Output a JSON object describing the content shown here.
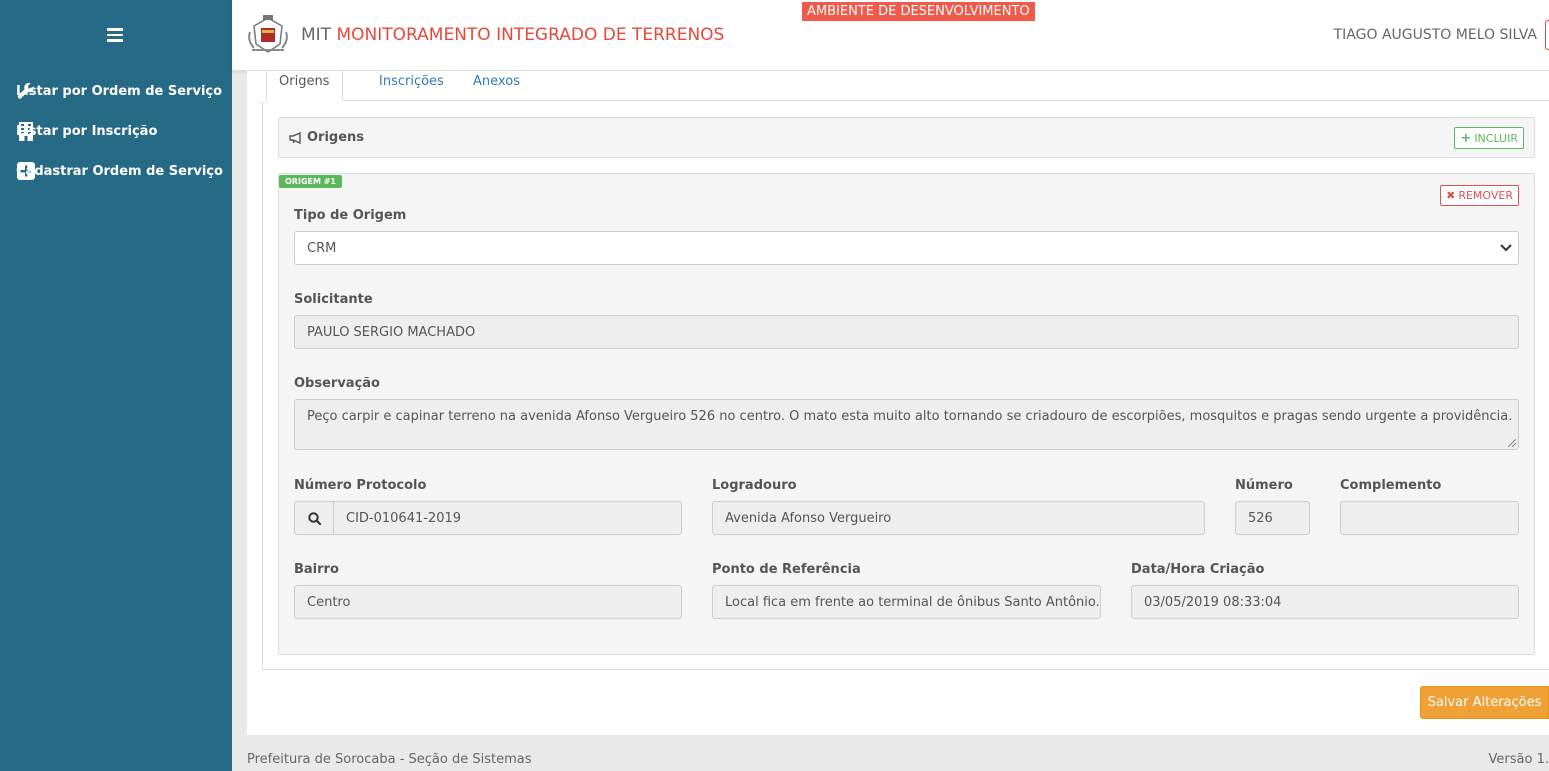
{
  "sidebar": {
    "items": [
      {
        "label": "Listar por Ordem de Serviço",
        "icon": "wrench-icon"
      },
      {
        "label": "Listar por Inscrição",
        "icon": "building-icon"
      },
      {
        "label": "Cadastrar Ordem de Serviço",
        "icon": "plus-square-icon"
      }
    ]
  },
  "header": {
    "brand_short": "MIT",
    "brand_full": "MONITORAMENTO INTEGRADO DE TERRENOS",
    "env_badge": "AMBIENTE DE DESENVOLVIMENTO",
    "user_name": "TIAGO AUGUSTO MELO SILVA"
  },
  "tabs": [
    {
      "label": "Origens",
      "active": true
    },
    {
      "label": "Inscrições",
      "active": false
    },
    {
      "label": "Anexos",
      "active": false
    }
  ],
  "origens_panel": {
    "title": "Origens",
    "add_label": "INCLUIR"
  },
  "origem": {
    "badge": "ORIGEM #1",
    "remove_label": "REMOVER",
    "tipo_origem": {
      "label": "Tipo de Origem",
      "value": "CRM"
    },
    "solicitante": {
      "label": "Solicitante",
      "value": "PAULO SERGIO MACHADO"
    },
    "observacao": {
      "label": "Observação",
      "value": "Peço carpir e capinar terreno na avenida Afonso Vergueiro 526 no centro. O mato esta muito alto tornando se criadouro de escorpiões, mosquitos e pragas sendo urgente a providência."
    },
    "numero_protocolo": {
      "label": "Número Protocolo",
      "value": "CID-010641-2019"
    },
    "logradouro": {
      "label": "Logradouro",
      "value": "Avenida Afonso Vergueiro"
    },
    "numero": {
      "label": "Número",
      "value": "526"
    },
    "complemento": {
      "label": "Complemento",
      "value": ""
    },
    "bairro": {
      "label": "Bairro",
      "value": "Centro"
    },
    "ponto_referencia": {
      "label": "Ponto de Referência",
      "value": "Local fica em frente ao terminal de ônibus Santo Antônio."
    },
    "data_criacao": {
      "label": "Data/Hora Criação",
      "value": "03/05/2019 08:33:04"
    }
  },
  "actions": {
    "save_label": "Salvar Alterações"
  },
  "footer": {
    "left": "Prefeitura de Sorocaba - Seção de Sistemas",
    "right": "Versão 1."
  },
  "colors": {
    "sidebar": "#266a86",
    "accent_red": "#e8483a",
    "success": "#5cb85c",
    "danger": "#d9534f",
    "warning": "#f0a136",
    "link": "#337ab7"
  }
}
